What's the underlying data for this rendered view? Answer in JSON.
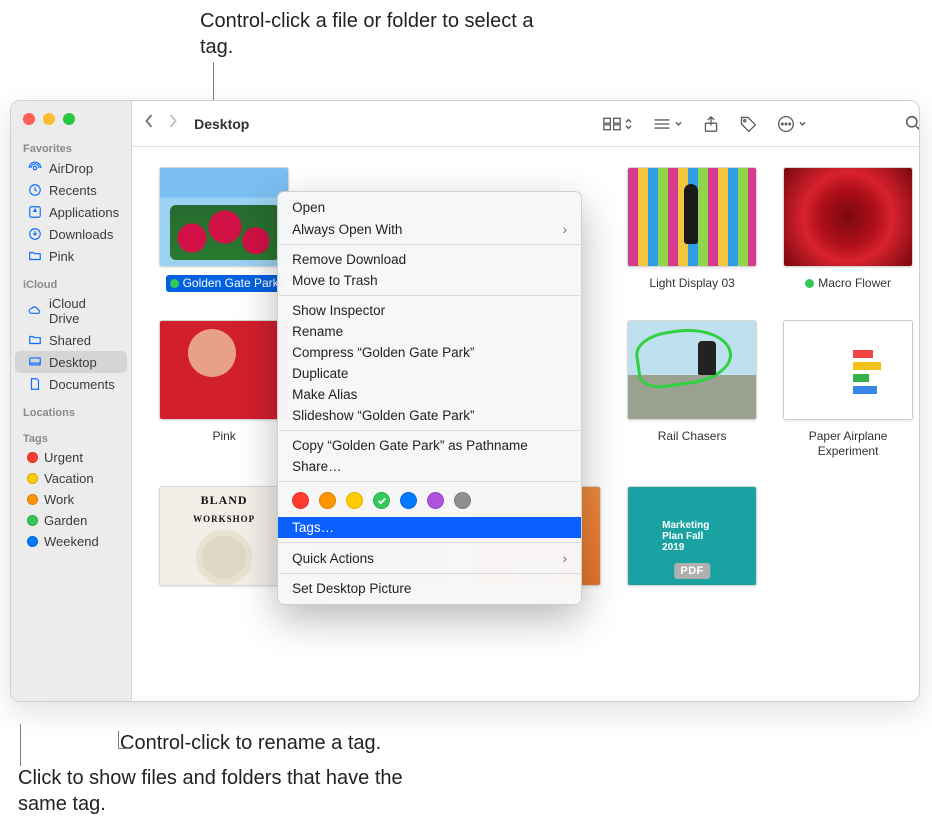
{
  "annotations": {
    "top": "Control-click a file or folder to select a tag.",
    "rename": "Control-click to rename a tag.",
    "show": "Click to show files and folders that have the same tag."
  },
  "toolbar": {
    "title": "Desktop"
  },
  "sidebar": {
    "sections": {
      "favorites": {
        "heading": "Favorites",
        "items": [
          "AirDrop",
          "Recents",
          "Applications",
          "Downloads",
          "Pink"
        ]
      },
      "icloud": {
        "heading": "iCloud",
        "items": [
          "iCloud Drive",
          "Shared",
          "Desktop",
          "Documents"
        ]
      },
      "locations": {
        "heading": "Locations"
      },
      "tags": {
        "heading": "Tags",
        "items": [
          {
            "label": "Urgent",
            "color": "#ff3b30"
          },
          {
            "label": "Vacation",
            "color": "#ffcc00"
          },
          {
            "label": "Work",
            "color": "#ff9500"
          },
          {
            "label": "Garden",
            "color": "#34c759"
          },
          {
            "label": "Weekend",
            "color": "#007aff"
          }
        ]
      }
    }
  },
  "files": {
    "r1": [
      {
        "name": "Golden Gate Park",
        "tag": "#34c759",
        "selected": true,
        "art": "flowers"
      },
      {
        "name": "",
        "art": "ctx-placeholder"
      },
      {
        "name": "",
        "art": "ctx-placeholder"
      },
      {
        "name": "Light Display 03",
        "art": "light"
      },
      {
        "name": "Macro Flower",
        "tag": "#34c759",
        "art": "macro"
      }
    ],
    "r2": [
      {
        "name": "Pink",
        "art": "pink"
      },
      {
        "name": "",
        "art": "ctx-placeholder"
      },
      {
        "name": "",
        "art": "ctx-placeholder"
      },
      {
        "name": "Rail Chasers",
        "art": "rail"
      },
      {
        "name": "Paper Airplane Experiment",
        "art": "paper"
      }
    ],
    "r3": [
      {
        "name": "",
        "art": "bland"
      },
      {
        "name": "",
        "art": "pdf1",
        "pdf": true
      },
      {
        "name": "",
        "art": "pdf2",
        "pdf": true
      },
      {
        "name": "",
        "art": "pdf3",
        "pdf": true,
        "pdftext": "Marketing Plan Fall 2019"
      }
    ]
  },
  "context_menu": {
    "open": "Open",
    "always_open": "Always Open With",
    "remove_download": "Remove Download",
    "trash": "Move to Trash",
    "show_inspector": "Show Inspector",
    "rename": "Rename",
    "compress": "Compress “Golden Gate Park”",
    "duplicate": "Duplicate",
    "alias": "Make Alias",
    "slideshow": "Slideshow “Golden Gate Park”",
    "copy_path": "Copy “Golden Gate Park” as Pathname",
    "share": "Share…",
    "tags": "Tags…",
    "quick_actions": "Quick Actions",
    "set_desktop": "Set Desktop Picture",
    "tag_colors": [
      "#ff3b30",
      "#ff9500",
      "#ffcc00",
      "#34c759",
      "#007aff",
      "#af52de",
      "#8e8e93"
    ],
    "tag_selected_index": 3
  },
  "pdf_badge": "PDF"
}
